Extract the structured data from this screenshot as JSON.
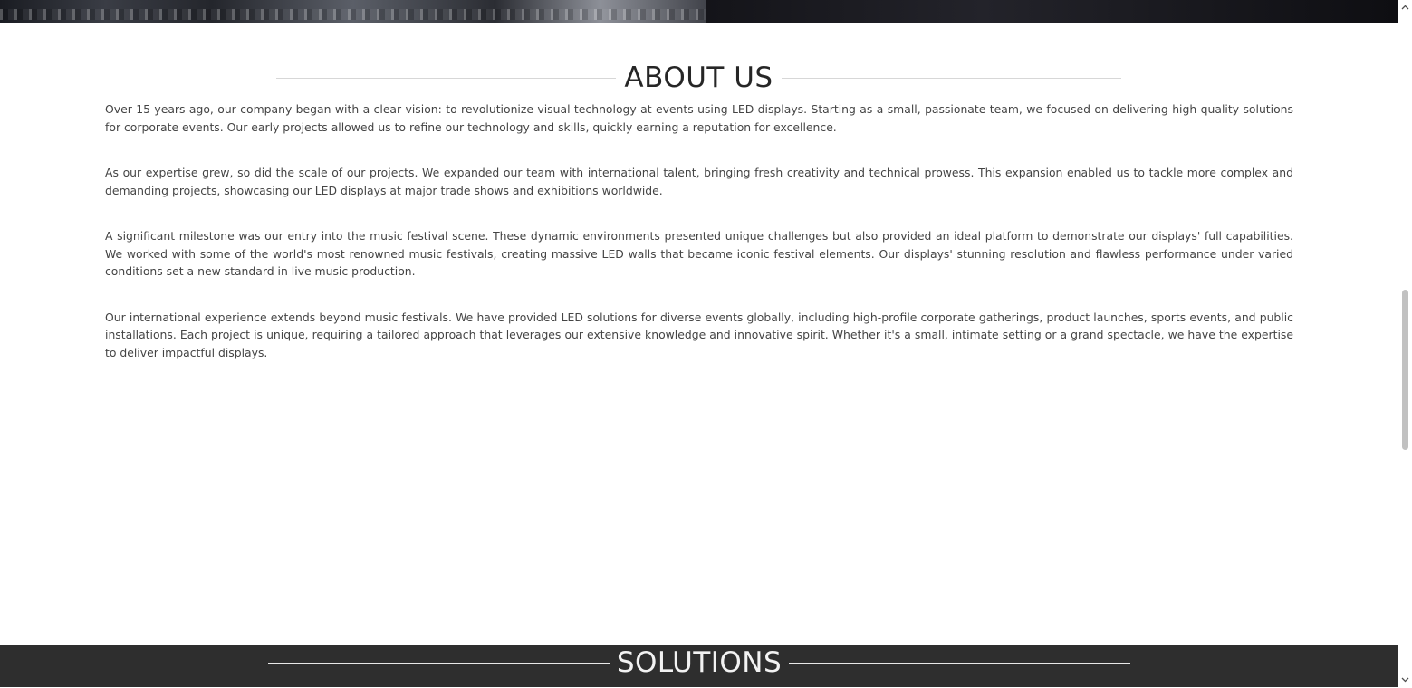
{
  "about": {
    "title": "ABOUT US",
    "paragraphs": [
      "Over 15 years ago, our company began with a clear vision: to revolutionize visual technology at events using LED displays. Starting as a small, passionate team, we focused on delivering high-quality solutions for corporate events. Our early projects allowed us to refine our technology and skills, quickly earning a reputation for excellence.",
      "As our expertise grew, so did the scale of our projects. We expanded our team with international talent, bringing fresh creativity and technical prowess. This expansion enabled us to tackle more complex and demanding projects, showcasing our LED displays at major trade shows and exhibitions worldwide.",
      "A significant milestone was our entry into the music festival scene. These dynamic environments presented unique challenges but also provided an ideal platform to demonstrate our displays' full capabilities. We worked with some of the world's most renowned music festivals, creating massive LED walls that became iconic festival elements. Our displays' stunning resolution and flawless performance under varied conditions set a new standard in live music production.",
      "Our international experience extends beyond music festivals. We have provided LED solutions for diverse events globally, including high-profile corporate gatherings, product launches, sports events, and public installations. Each project is unique, requiring a tailored approach that leverages our extensive knowledge and innovative spirit. Whether it's a small, intimate setting or a grand spectacle, we have the expertise to deliver impactful displays."
    ]
  },
  "solutions": {
    "title": "SOLUTIONS"
  },
  "scrollbar": {
    "up_icon": "chevron-up-icon",
    "down_icon": "chevron-down-icon"
  },
  "colors": {
    "heading_text": "#262626",
    "body_text": "#444444",
    "divider": "#d7d7d7",
    "solutions_bg": "#2e2e2e",
    "solutions_text": "#f2f2f2"
  }
}
